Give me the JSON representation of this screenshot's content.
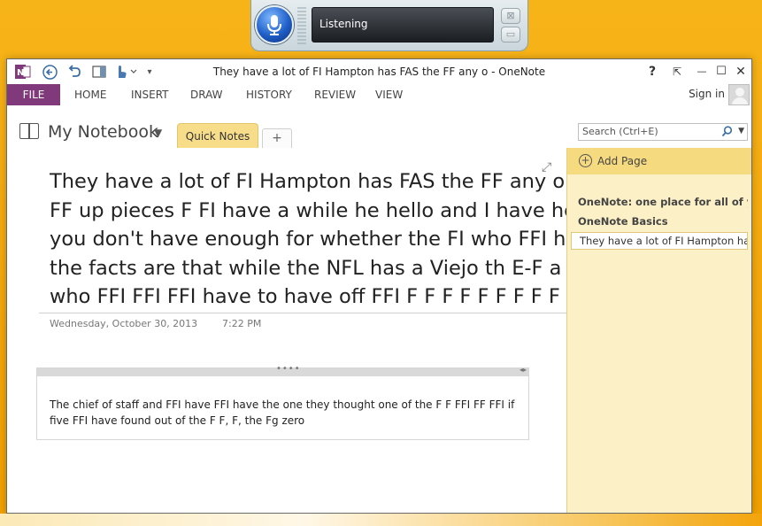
{
  "speech": {
    "status": "Listening",
    "close_glyph": "⊠",
    "min_glyph": "▭",
    "mic_icon": "microphone-icon"
  },
  "window": {
    "title": "They have a lot of FI Hampton has FAS the FF any o - OneNote",
    "controls": {
      "help": "?",
      "ribbon_display": "⇱",
      "minimize": "—",
      "maximize": "☐",
      "close": "✕"
    }
  },
  "ribbon": {
    "file": "FILE",
    "tabs": [
      "HOME",
      "INSERT",
      "DRAW",
      "HISTORY",
      "REVIEW",
      "VIEW"
    ],
    "signin": "Sign in",
    "file_color": "#80397B"
  },
  "notebook": {
    "name": "My Notebook",
    "section": "Quick Notes",
    "add_section": "+"
  },
  "search": {
    "placeholder": "Search (Ctrl+E)"
  },
  "page": {
    "title_lines": [
      "They have a lot of FI Hampton has FAS the FF any or the",
      "FF up pieces F FI have a while he hello and I have he and",
      "you don't have enough for whether the FI who FFI have",
      "the facts are that while the NFL has a Viejo th E-F a fellow",
      "who FFI FFI FFI have to have off FFI F F F F F F F F F F if"
    ],
    "date": "Wednesday, October 30, 2013",
    "time": "7:22 PM",
    "note": "The chief of staff and FFI have FFI have the one they thought one of the F F FFI FF FFI if five FFI have found out of the F F, F, the Fg zero"
  },
  "sidebar": {
    "add_page": "Add Page",
    "pages": [
      "OneNote: one place for all of your",
      "OneNote Basics"
    ],
    "active_page": "They have a lot of FI Hampton ha"
  }
}
